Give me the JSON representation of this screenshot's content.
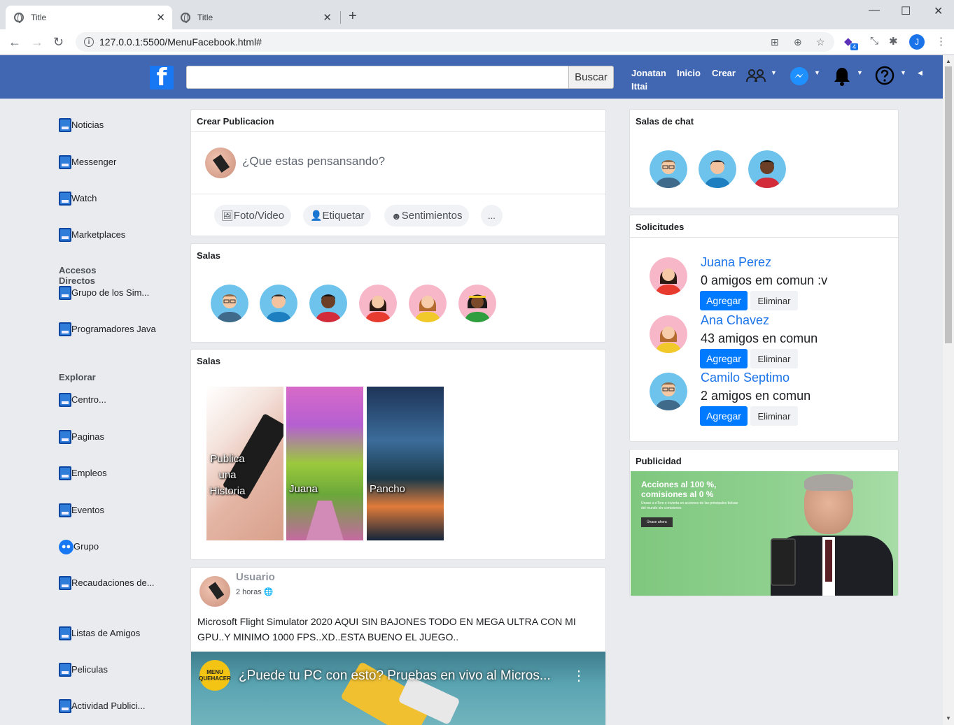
{
  "browser": {
    "tabs": [
      {
        "title": "Title"
      },
      {
        "title": "Title"
      }
    ],
    "url": "127.0.0.1:5500/MenuFacebook.html#",
    "profile_initial": "J",
    "extension_badge": "4"
  },
  "header": {
    "search_placeholder": "",
    "search_button": "Buscar",
    "user_name_line1": "Jonatan",
    "user_name_line2": "Ittai",
    "home": "Inicio",
    "create": "Crear"
  },
  "sidebar": {
    "items": [
      {
        "label": "Noticias"
      },
      {
        "label": "Messenger"
      },
      {
        "label": "Watch"
      },
      {
        "label": "Marketplaces"
      }
    ],
    "shortcuts_title": "Accesos Directos",
    "shortcuts": [
      {
        "label": "Grupo de los Sim..."
      },
      {
        "label": "Programadores Java"
      }
    ],
    "explore_title": "Explorar",
    "explore": [
      {
        "label": "Centro..."
      },
      {
        "label": "Paginas"
      },
      {
        "label": "Empleos"
      },
      {
        "label": "Eventos"
      },
      {
        "label": "Grupo"
      },
      {
        "label": "Recaudaciones de..."
      },
      {
        "label": "Listas de Amigos"
      },
      {
        "label": "Peliculas"
      },
      {
        "label": "Actividad Publici..."
      }
    ]
  },
  "create_post": {
    "title": "Crear Publicacion",
    "placeholder": "¿Que estas pensansando?",
    "actions": [
      "Foto/Video",
      "Etiquetar",
      "Sentimientos",
      "..."
    ]
  },
  "rooms": {
    "title": "Salas"
  },
  "stories": {
    "title": "Salas",
    "items": [
      {
        "label": "Publica una Historia"
      },
      {
        "label": "Juana"
      },
      {
        "label": "Pancho"
      }
    ]
  },
  "post": {
    "author": "Usuario",
    "time": "2 horas",
    "text": "Microsoft Flight Simulator 2020 AQUI SIN BAJONES TODO EN MEGA ULTRA CON MI GPU..Y MINIMO 1000 FPS..XD..ESTA BUENO EL JUEGO..",
    "video_title": "¿Puede tu PC con esto? Pruebas en vivo al Micros...",
    "channel_badge": "MENU QUEHACER"
  },
  "chat_rooms": {
    "title": "Salas de chat"
  },
  "requests": {
    "title": "Solicitudes",
    "items": [
      {
        "name": "Juana Perez",
        "common": "0 amigos em comun :v",
        "add": "Agregar",
        "remove": "Eliminar"
      },
      {
        "name": "Ana Chavez",
        "common": "43 amigos en comun",
        "add": "Agregar",
        "remove": "Eliminar"
      },
      {
        "name": "Camilo Septimo",
        "common": "2 amigos en comun",
        "add": "Agregar",
        "remove": "Eliminar"
      }
    ]
  },
  "ads": {
    "title": "Publicidad",
    "headline1": "Acciones al 100 %,",
    "headline2": "comisiones al 0 %",
    "subtext": "Únase a eToro e invierta en acciones de las principales bolsas del mundo sin comisiones",
    "cta": "Únase ahora"
  },
  "colors": {
    "fb_blue": "#4267b2",
    "button_blue": "#007bff",
    "link_blue": "#1a73e8"
  }
}
